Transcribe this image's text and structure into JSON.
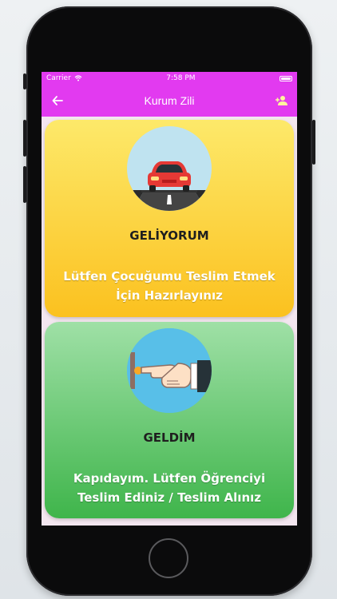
{
  "status": {
    "carrier": "Carrier",
    "time": "7:58 PM"
  },
  "header": {
    "title": "Kurum Zili"
  },
  "cards": [
    {
      "title": "GELİYORUM",
      "message": "Lütfen Çocuğumu Teslim Etmek İçin Hazırlayınız",
      "icon": "car-on-road-icon"
    },
    {
      "title": "GELDİM",
      "message": "Kapıdayım. Lütfen Öğrenciyi Teslim Ediniz / Teslim Alınız",
      "icon": "doorbell-press-icon"
    }
  ],
  "colors": {
    "accent": "#e23af0",
    "card_yellow": "#fbc11f",
    "card_green": "#3fb54b"
  }
}
